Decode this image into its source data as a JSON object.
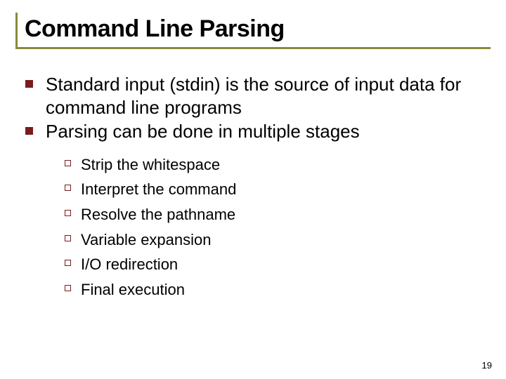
{
  "slide": {
    "title": "Command Line Parsing",
    "bullets": [
      {
        "text": "Standard input (stdin) is the source of input data for command line programs"
      },
      {
        "text": "Parsing can be done in multiple stages"
      }
    ],
    "subbullets": [
      {
        "text": "Strip the whitespace"
      },
      {
        "text": "Interpret the command"
      },
      {
        "text": "Resolve the pathname"
      },
      {
        "text": "Variable expansion"
      },
      {
        "text": "I/O redirection"
      },
      {
        "text": "Final execution"
      }
    ],
    "page_number": "19"
  }
}
